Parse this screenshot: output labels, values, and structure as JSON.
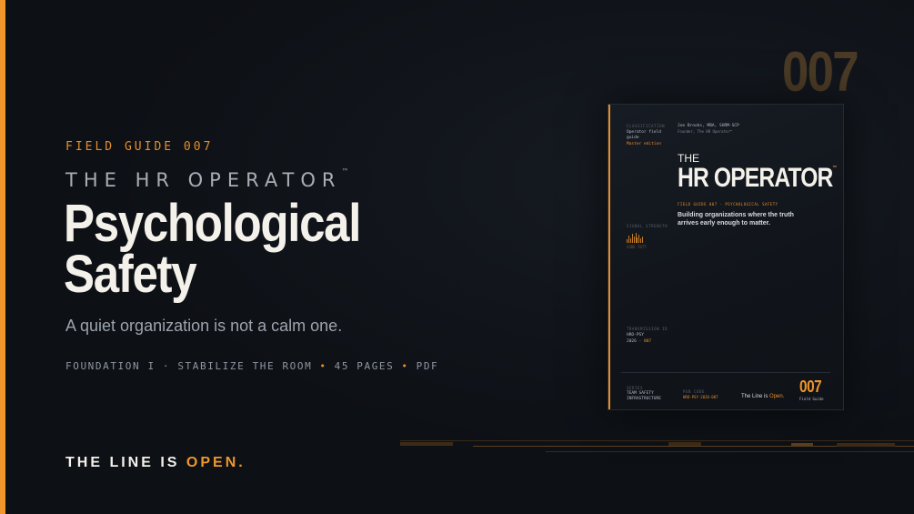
{
  "hero": {
    "eyebrow": "FIELD GUIDE 007",
    "brand": "THE HR OPERATOR",
    "brand_tm": "™",
    "headline_line1": "Psychological",
    "headline_line2": "Safety",
    "tagline": "A quiet organization is not a calm one.",
    "meta": {
      "foundation": "FOUNDATION I · STABILIZE THE ROOM",
      "pages": "45 PAGES",
      "format": "PDF",
      "separator": "•"
    },
    "footer_prefix": "THE LINE IS",
    "footer_open": "OPEN."
  },
  "big_number": "007",
  "cover": {
    "classification_label": "CLASSIFICATION",
    "classification_value": "Operator field guide",
    "edition": "Master edition",
    "author": "Joe Brooks, MBA, SHRM-SCP",
    "author_sub": "Founder, The HR Operator™",
    "the": "THE",
    "title": "HR OPERATOR",
    "title_tm": "™",
    "field_guide_line": "FIELD GUIDE 007 · PSYCHOLOGICAL SAFETY",
    "description": "Building organizations where the truth arrives early enough to matter.",
    "signal_label": "SIGNAL STRENGTH",
    "signal_code": "CODE 7677",
    "signal_levels": [
      0.4,
      0.7,
      0.5,
      0.9,
      0.6,
      1.0,
      0.55,
      0.8,
      0.45,
      0.65
    ],
    "transmission_label": "TRANSMISSION ID",
    "transmission_value": "HRO-PSY",
    "transmission_year": "2026",
    "transmission_suffix": "007",
    "series_label": "SERIES",
    "series_value": "TEAM SAFETY INFRASTRUCTURE",
    "pub_label": "PUB CODE",
    "pub_value": "HRO-PSY-2026-007",
    "line_prefix": "The Line is",
    "line_open": "Open.",
    "number": "007",
    "number_sub": "Field Guide"
  },
  "colors": {
    "accent": "#f0962b",
    "background": "#0d1015",
    "headline": "#f4f1ea"
  }
}
